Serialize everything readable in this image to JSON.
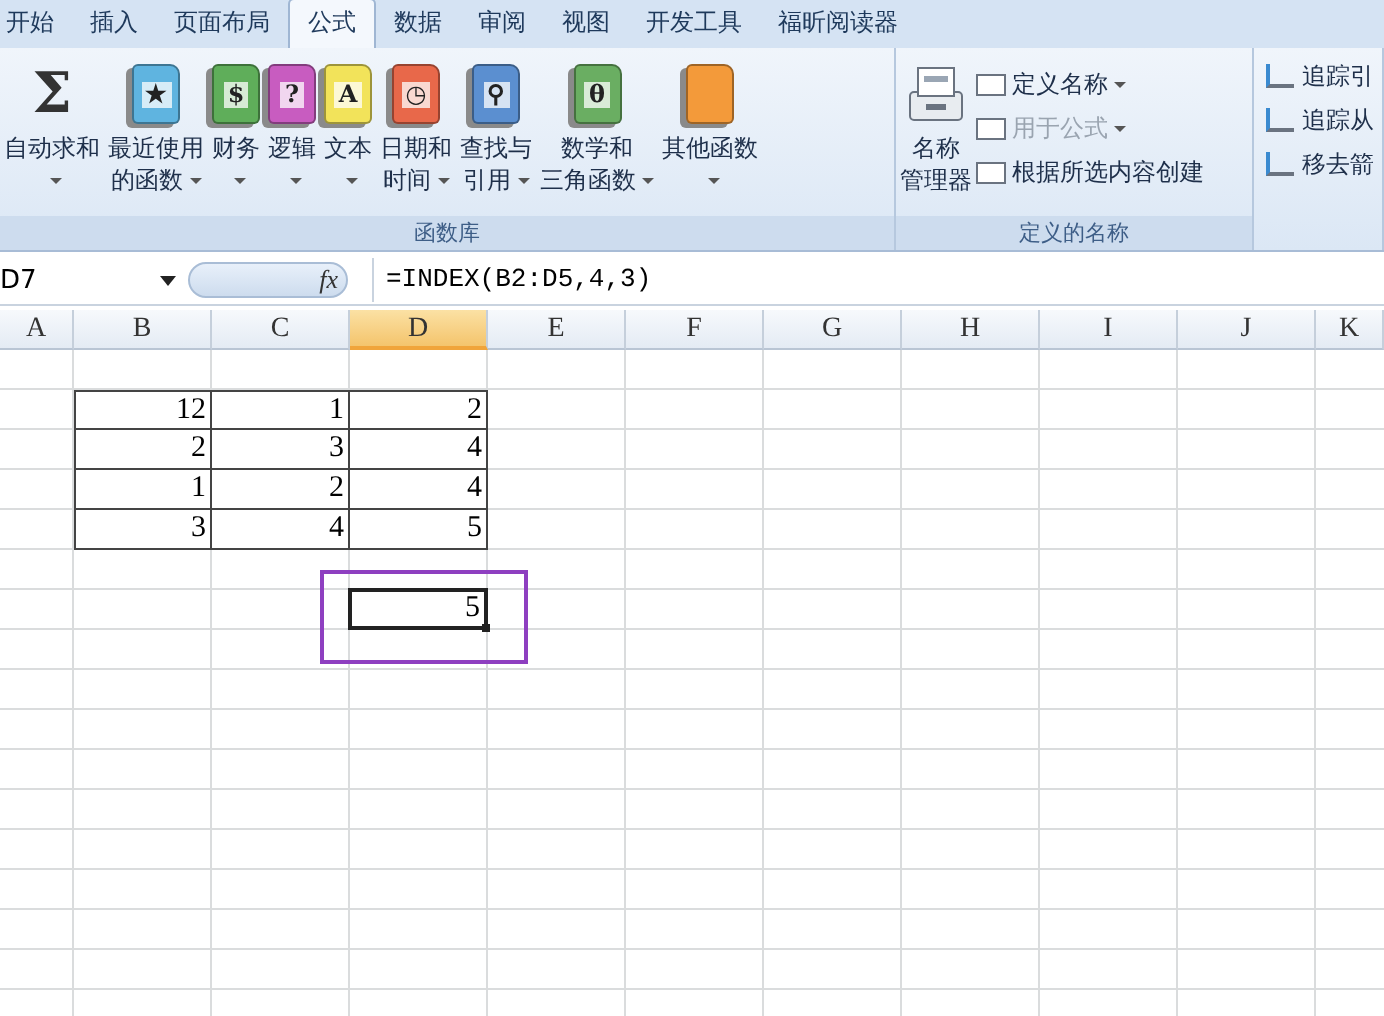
{
  "tabs": [
    {
      "label": "开始",
      "selected": false
    },
    {
      "label": "插入",
      "selected": false
    },
    {
      "label": "页面布局",
      "selected": false
    },
    {
      "label": "公式",
      "selected": true
    },
    {
      "label": "数据",
      "selected": false
    },
    {
      "label": "审阅",
      "selected": false
    },
    {
      "label": "视图",
      "selected": false
    },
    {
      "label": "开发工具",
      "selected": false
    },
    {
      "label": "福昕阅读器",
      "selected": false
    }
  ],
  "ribbon": {
    "function_library": {
      "title": "函数库",
      "buttons": [
        {
          "kind": "sigma",
          "symbol": "Σ",
          "lines": [
            "自动求和"
          ],
          "dropdown": true
        },
        {
          "kind": "book",
          "color": "#5fb4e0",
          "symbol": "★",
          "lines": [
            "最近使用",
            "的函数"
          ],
          "dropdown": true
        },
        {
          "kind": "book",
          "color": "#5fae5a",
          "symbol": "$",
          "lines": [
            "财务"
          ],
          "dropdown": true
        },
        {
          "kind": "book",
          "color": "#c85cc0",
          "symbol": "?",
          "lines": [
            "逻辑"
          ],
          "dropdown": true
        },
        {
          "kind": "book",
          "color": "#f2e35a",
          "symbol": "A",
          "lines": [
            "文本"
          ],
          "dropdown": true
        },
        {
          "kind": "book",
          "color": "#e8684a",
          "symbol": "◷",
          "lines": [
            "日期和",
            "时间"
          ],
          "dropdown": true
        },
        {
          "kind": "book",
          "color": "#5b8fd0",
          "symbol": "⚲",
          "lines": [
            "查找与",
            "引用"
          ],
          "dropdown": true
        },
        {
          "kind": "book",
          "color": "#6aae62",
          "symbol": "θ",
          "lines": [
            "数学和",
            "三角函数"
          ],
          "dropdown": true
        },
        {
          "kind": "book",
          "color": "#f39a3a",
          "lines": [
            "其他函数"
          ],
          "dropdown": true
        }
      ]
    },
    "defined_names": {
      "title": "定义的名称",
      "manager": {
        "lines": [
          "名称",
          "管理器"
        ]
      },
      "items": [
        {
          "label": "定义名称",
          "dropdown": true,
          "disabled": false
        },
        {
          "label": "用于公式",
          "dropdown": true,
          "disabled": true
        },
        {
          "label": "根据所选内容创建",
          "dropdown": false,
          "disabled": false
        }
      ]
    },
    "auditing": {
      "items": [
        {
          "label": "追踪引"
        },
        {
          "label": "追踪从"
        },
        {
          "label": "移去箭"
        }
      ]
    }
  },
  "formula_bar": {
    "name_box": "D7",
    "function_button": "fx",
    "formula": "=INDEX(B2:D5,4,3)"
  },
  "sheet": {
    "columns": [
      {
        "label": "A",
        "selected": false
      },
      {
        "label": "B",
        "selected": false
      },
      {
        "label": "C",
        "selected": false
      },
      {
        "label": "D",
        "selected": true
      },
      {
        "label": "E",
        "selected": false
      },
      {
        "label": "F",
        "selected": false
      },
      {
        "label": "G",
        "selected": false
      },
      {
        "label": "H",
        "selected": false
      },
      {
        "label": "I",
        "selected": false
      },
      {
        "label": "J",
        "selected": false
      },
      {
        "label": "K",
        "selected": false
      }
    ],
    "data_rows": [
      [
        "12",
        "1",
        "2"
      ],
      [
        "2",
        "3",
        "4"
      ],
      [
        "1",
        "2",
        "4"
      ],
      [
        "3",
        "4",
        "5"
      ]
    ],
    "active_cell": {
      "value": "5"
    }
  }
}
